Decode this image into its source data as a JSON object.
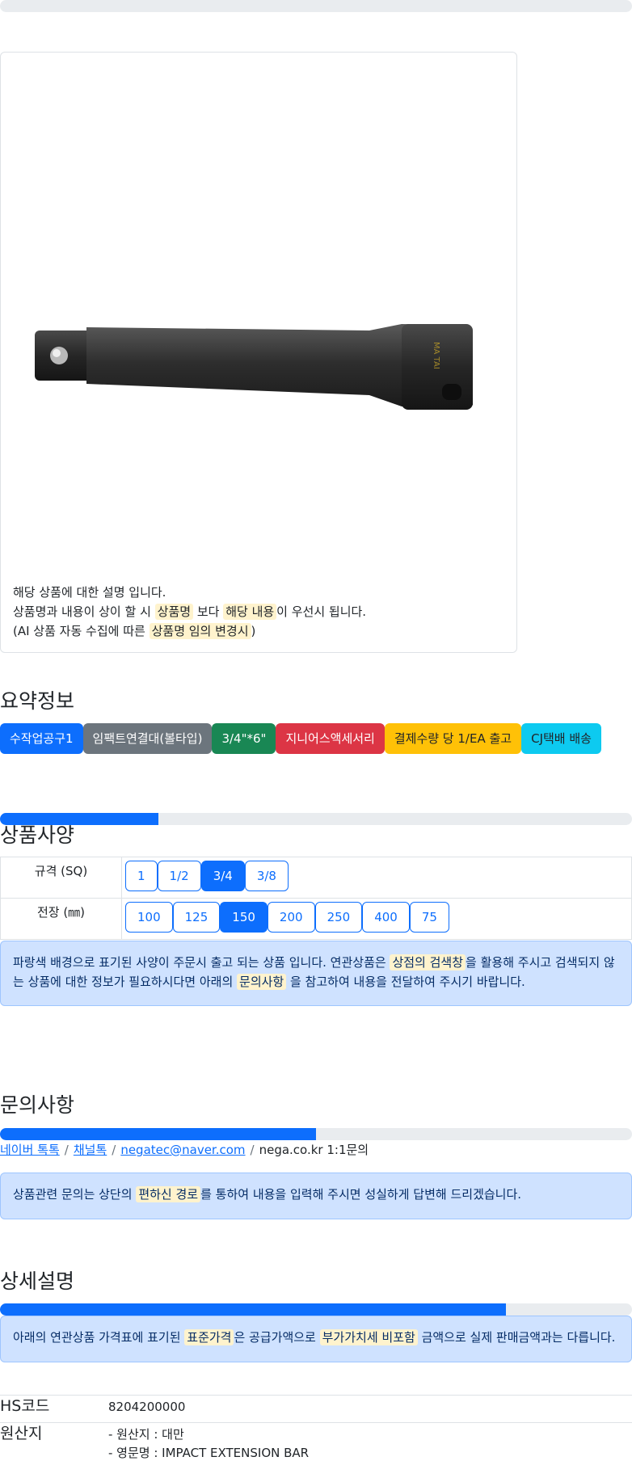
{
  "top_progress": 0,
  "product": {
    "image_alt_text": "MA TAI",
    "description_line1": "해당 상품에 대한 설명 입니다.",
    "description_line2_a": "상품명과 내용이 상이 할 시 ",
    "description_line2_hl1": "상품명",
    "description_line2_b": " 보다 ",
    "description_line2_hl2": "해당 내용",
    "description_line2_c": "이 우선시 됩니다.",
    "description_line3_a": "(AI 상품 자동 수집에 따른 ",
    "description_line3_hl": "상품명 임의 변경시",
    "description_line3_b": ")"
  },
  "summary": {
    "title": "요약정보",
    "badges": [
      "수작업공구1",
      "임팩트연결대(볼타입)",
      "3/4\"*6\"",
      "지니어스액세서리",
      "결제수량 당 1/EA 출고",
      "CJ택배 배송"
    ]
  },
  "spec": {
    "progress": 0.25,
    "title": "상품사양",
    "rows": [
      {
        "label": "규격 (SQ)",
        "options": [
          "1",
          "1/2",
          "3/4",
          "3/8"
        ],
        "selected": 2
      },
      {
        "label": "전장 (㎜)",
        "options": [
          "100",
          "125",
          "150",
          "200",
          "250",
          "400",
          "75"
        ],
        "selected": 2
      }
    ],
    "notice_a": "파랑색 배경으로 표기된 사양이 주문시 출고 되는 상품 입니다. 연관상품은 ",
    "notice_hl1": "상점의 검색창",
    "notice_b": "을 활용해 주시고 검색되지 않는 상품에 대한 정보가 필요하시다면 아래의 ",
    "notice_hl2": "문의사항",
    "notice_c": " 을 참고하여 내용을 전달하여 주시기 바랍니다."
  },
  "inquiry": {
    "title": "문의사항",
    "progress": 0.5,
    "link1": "네이버 톡톡",
    "link2": "채널톡",
    "link3": "negatec@naver.com",
    "plain": "nega.co.kr 1:1문의",
    "separator": "/",
    "notice_a": "상품관련 문의는 상단의 ",
    "notice_hl": "편하신 경로",
    "notice_b": "를 통하여 내용을 입력해 주시면 성실하게 답변해 드리겠습니다."
  },
  "detail": {
    "title": "상세설명",
    "progress": 0.8,
    "notice_a": "아래의 연관상품 가격표에 표기된 ",
    "notice_hl1": "표준가격",
    "notice_b": "은 공급가액으로 ",
    "notice_hl2": "부가가치세 비포함",
    "notice_c": " 금액으로 실제 판매금액과는 다릅니다.",
    "hs_label": "HS코드",
    "hs_value": "8204200000",
    "origin_label": "원산지",
    "origin_line1": "- 원산지 : 대만",
    "origin_line2": "- 영문명 : IMPACT EXTENSION BAR"
  },
  "colors": {
    "primary": "#0d6efd",
    "secondary": "#6c757d",
    "success": "#198754",
    "danger": "#dc3545",
    "warning": "#ffc107",
    "info": "#0dcaf0",
    "highlight": "#fff3cd",
    "alert_bg": "#cfe2ff"
  }
}
